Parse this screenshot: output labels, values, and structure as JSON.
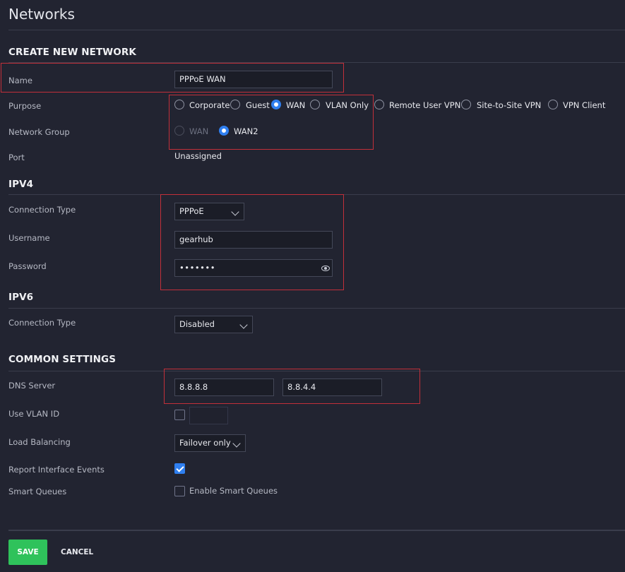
{
  "page": {
    "title": "Networks"
  },
  "create": {
    "section": "CREATE NEW NETWORK",
    "name_label": "Name",
    "name_value": "PPPoE WAN",
    "purpose_label": "Purpose",
    "purpose_options": [
      "Corporate",
      "Guest",
      "WAN",
      "VLAN Only",
      "Remote User VPN",
      "Site-to-Site VPN",
      "VPN Client"
    ],
    "purpose_selected": "WAN",
    "group_label": "Network Group",
    "group_options": [
      "WAN",
      "WAN2"
    ],
    "group_selected": "WAN2",
    "port_label": "Port",
    "port_value": "Unassigned"
  },
  "ipv4": {
    "section": "IPV4",
    "conn_label": "Connection Type",
    "conn_value": "PPPoE",
    "user_label": "Username",
    "user_value": "gearhub",
    "pass_label": "Password",
    "pass_value": "•••••••"
  },
  "ipv6": {
    "section": "IPV6",
    "conn_label": "Connection Type",
    "conn_value": "Disabled"
  },
  "common": {
    "section": "COMMON SETTINGS",
    "dns_label": "DNS Server",
    "dns1": "8.8.8.8",
    "dns2": "8.8.4.4",
    "vlan_label": "Use VLAN ID",
    "vlan_checked": false,
    "lb_label": "Load Balancing",
    "lb_value": "Failover only",
    "report_label": "Report Interface Events",
    "report_checked": true,
    "sq_label": "Smart Queues",
    "sq_checkbox_label": "Enable Smart Queues",
    "sq_checked": false
  },
  "actions": {
    "save": "SAVE",
    "cancel": "CANCEL"
  },
  "colors": {
    "accent": "#2f7ff0",
    "save": "#2fc25b",
    "highlight": "#c2303a",
    "background": "#222431"
  }
}
